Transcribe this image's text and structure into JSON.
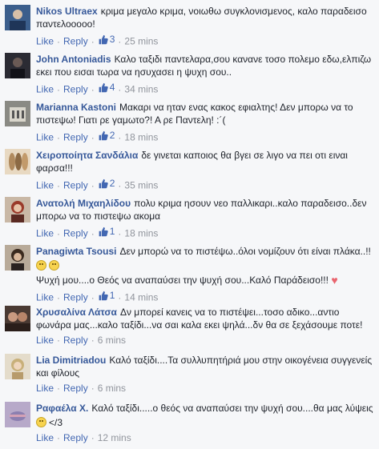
{
  "comments": [
    {
      "author": "Nikos Ultraex",
      "text": "κριμα μεγαλο κριμα, νοιωθω συγκλονισμενος, καλο παραδεισο παντελοοοοο!",
      "like": "Like",
      "reply": "Reply",
      "likes": "3",
      "time": "25 mins",
      "avatar_color": "#3b5e8c"
    },
    {
      "author": "John Antoniadis",
      "text": "Καλο ταξιδι παντελαρα,σου κανανε τοσο πολεμο εδω,ελπιζω εκει που εισαι τωρα να ησυχασει η ψυχη σου..",
      "like": "Like",
      "reply": "Reply",
      "likes": "4",
      "time": "34 mins",
      "avatar_color": "#2b2b33"
    },
    {
      "author": "Marianna Kastoni",
      "text": "Μακαρι να ηταν ενας κακος εφιαλτης! Δεν μπορω να το πιστεψω! Γιατι ρε γαμωτο?! Α ρε Παντελη! :´(",
      "like": "Like",
      "reply": "Reply",
      "likes": "2",
      "time": "18 mins",
      "avatar_color": "#8a8a84"
    },
    {
      "author": "Χειροποίητα Σανδάλια",
      "text": "δε γινεται καποιος θα βγει σε λιγο να πει οτι ειναι φαρσα!!!",
      "like": "Like",
      "reply": "Reply",
      "likes": "2",
      "time": "35 mins",
      "avatar_color": "#b08a5e"
    },
    {
      "author": "Ανατολή Μιχαηλίδου",
      "text": "πολυ κριμα ησουν νεο παλλικαρι..καλο παραδεισο..δεν μπορω να το πιστεψω ακομα",
      "like": "Like",
      "reply": "Reply",
      "likes": "1",
      "time": "18 mins",
      "avatar_color": "#9a3a2a"
    },
    {
      "author": "Panagiwta Tsousi",
      "text": "Δεν μπορώ να το πιστέψω..όλοι νομίζουν ότι είναι πλάκα..!!",
      "extra": "Ψυχή μου....ο Θεός να αναπαύσει την ψυχή σου...Καλό Παράδεισο!!!",
      "like": "Like",
      "reply": "Reply",
      "likes": "1",
      "time": "14 mins",
      "avatar_color": "#5a4a3a"
    },
    {
      "author": "Χρυσαλίνα Λάτσα",
      "text": "Δν μπορεί κανεις να το πιστέψει...τοσο αδικο...αντιο φωνάρα μας...καλο ταξίδι...να σαι καλα εκει ψηλά...δν θα σε ξεχάσουμε ποτε!",
      "like": "Like",
      "reply": "Reply",
      "time": "6 mins",
      "avatar_color": "#4a3a33"
    },
    {
      "author": "Lia Dimitriadou",
      "text": "Καλό ταξίδι....Τα συλλυπητήριά μου στην οικογένεια συγγενείς και φίλους",
      "like": "Like",
      "reply": "Reply",
      "time": "6 mins",
      "avatar_color": "#c8b07a"
    },
    {
      "author": "Ραφαέλα Χ.",
      "text": "Καλό ταξίδι.....ο θεός να αναπαύσει την ψυχή σου....θα μας λύψεις",
      "extra": "</3",
      "like": "Like",
      "reply": "Reply",
      "time": "12 mins",
      "avatar_color": "#8c7fb0"
    }
  ]
}
